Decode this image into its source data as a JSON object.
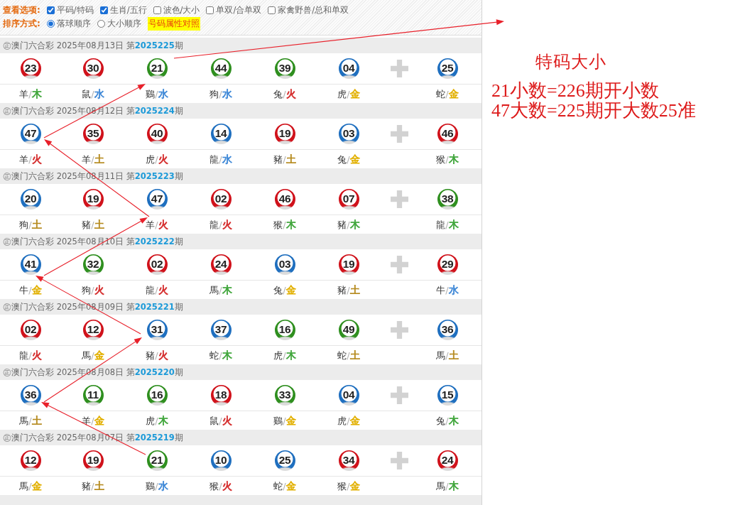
{
  "options": {
    "label": "查看选项:",
    "checkboxes": [
      {
        "label": "平码/特码",
        "checked": true
      },
      {
        "label": "生肖/五行",
        "checked": true
      },
      {
        "label": "波色/大小",
        "checked": false
      },
      {
        "label": "单双/合单双",
        "checked": false
      },
      {
        "label": "家禽野兽/总和单双",
        "checked": false
      }
    ]
  },
  "sort": {
    "label": "排序方式:",
    "radios": [
      {
        "label": "落球顺序",
        "selected": true
      },
      {
        "label": "大小顺序",
        "selected": false
      }
    ],
    "button": "号码属性对照"
  },
  "draws": [
    {
      "header": "㊣澳门六合彩 2025年08月13日 第**2025225**期",
      "balls": [
        {
          "number": "23",
          "color": "#d0121b",
          "label": {
            "zodiac": "羊",
            "separator": "/",
            "element": "木",
            "color": "#41a63c"
          }
        },
        {
          "number": "30",
          "color": "#d0121b",
          "label": {
            "zodiac": "鼠",
            "separator": "/",
            "element": "水",
            "color": "#3b86d6"
          }
        },
        {
          "number": "21",
          "color": "#2f8f1f",
          "label": {
            "zodiac": "鷄",
            "separator": "/",
            "element": "水",
            "color": "#3b86d6"
          }
        },
        {
          "number": "44",
          "color": "#2f8f1f",
          "label": {
            "zodiac": "狗",
            "separator": "/",
            "element": "水",
            "color": "#3b86d6"
          }
        },
        {
          "number": "39",
          "color": "#2f8f1f",
          "label": {
            "zodiac": "兔",
            "separator": "/",
            "element": "火",
            "color": "#d42a2a"
          }
        },
        {
          "number": "04",
          "color": "#1f6fbf",
          "label": {
            "zodiac": "虎",
            "separator": "/",
            "element": "金",
            "color": "#e2b000"
          }
        }
      ],
      "special_ball": {
        "number": "25",
        "color": "#1f6fbf",
        "label": {
          "zodiac": "蛇",
          "separator": "/",
          "element": "金",
          "color": "#e2b000"
        }
      }
    },
    {
      "header": "㊣澳门六合彩 2025年08月12日 第**2025224**期",
      "balls": [
        {
          "number": "47",
          "color": "#1f6fbf",
          "label": {
            "zodiac": "羊",
            "separator": "/",
            "element": "火",
            "color": "#d42a2a"
          }
        },
        {
          "number": "35",
          "color": "#d0121b",
          "label": {
            "zodiac": "羊",
            "separator": "/",
            "element": "土",
            "color": "#b58a1e"
          }
        },
        {
          "number": "40",
          "color": "#d0121b",
          "label": {
            "zodiac": "虎",
            "separator": "/",
            "element": "火",
            "color": "#d42a2a"
          }
        },
        {
          "number": "14",
          "color": "#1f6fbf",
          "label": {
            "zodiac": "龍",
            "separator": "/",
            "element": "水",
            "color": "#3b86d6"
          }
        },
        {
          "number": "19",
          "color": "#d0121b",
          "label": {
            "zodiac": "豬",
            "separator": "/",
            "element": "土",
            "color": "#b58a1e"
          }
        },
        {
          "number": "03",
          "color": "#1f6fbf",
          "label": {
            "zodiac": "兔",
            "separator": "/",
            "element": "金",
            "color": "#e2b000"
          }
        }
      ],
      "special_ball": {
        "number": "46",
        "color": "#d0121b",
        "label": {
          "zodiac": "猴",
          "separator": "/",
          "element": "木",
          "color": "#41a63c"
        }
      }
    },
    {
      "header": "㊣澳门六合彩 2025年08月11日 第**2025223**期",
      "balls": [
        {
          "number": "20",
          "color": "#1f6fbf",
          "label": {
            "zodiac": "狗",
            "separator": "/",
            "element": "土",
            "color": "#b58a1e"
          }
        },
        {
          "number": "19",
          "color": "#d0121b",
          "label": {
            "zodiac": "豬",
            "separator": "/",
            "element": "土",
            "color": "#b58a1e"
          }
        },
        {
          "number": "47",
          "color": "#1f6fbf",
          "label": {
            "zodiac": "羊",
            "separator": "/",
            "element": "火",
            "color": "#d42a2a"
          }
        },
        {
          "number": "02",
          "color": "#d0121b",
          "label": {
            "zodiac": "龍",
            "separator": "/",
            "element": "火",
            "color": "#d42a2a"
          }
        },
        {
          "number": "46",
          "color": "#d0121b",
          "label": {
            "zodiac": "猴",
            "separator": "/",
            "element": "木",
            "color": "#41a63c"
          }
        },
        {
          "number": "07",
          "color": "#d0121b",
          "label": {
            "zodiac": "豬",
            "separator": "/",
            "element": "木",
            "color": "#41a63c"
          }
        }
      ],
      "special_ball": {
        "number": "38",
        "color": "#2f8f1f",
        "label": {
          "zodiac": "龍",
          "separator": "/",
          "element": "木",
          "color": "#41a63c"
        }
      }
    },
    {
      "header": "㊣澳门六合彩 2025年08月10日 第**2025222**期",
      "balls": [
        {
          "number": "41",
          "color": "#1f6fbf",
          "label": {
            "zodiac": "牛",
            "separator": "/",
            "element": "金",
            "color": "#e2b000"
          }
        },
        {
          "number": "32",
          "color": "#2f8f1f",
          "label": {
            "zodiac": "狗",
            "separator": "/",
            "element": "火",
            "color": "#d42a2a"
          }
        },
        {
          "number": "02",
          "color": "#d0121b",
          "label": {
            "zodiac": "龍",
            "separator": "/",
            "element": "火",
            "color": "#d42a2a"
          }
        },
        {
          "number": "24",
          "color": "#d0121b",
          "label": {
            "zodiac": "馬",
            "separator": "/",
            "element": "木",
            "color": "#41a63c"
          }
        },
        {
          "number": "03",
          "color": "#1f6fbf",
          "label": {
            "zodiac": "兔",
            "separator": "/",
            "element": "金",
            "color": "#e2b000"
          }
        },
        {
          "number": "19",
          "color": "#d0121b",
          "label": {
            "zodiac": "豬",
            "separator": "/",
            "element": "土",
            "color": "#b58a1e"
          }
        }
      ],
      "special_ball": {
        "number": "29",
        "color": "#d0121b",
        "label": {
          "zodiac": "牛",
          "separator": "/",
          "element": "水",
          "color": "#3b86d6"
        }
      }
    },
    {
      "header": "㊣澳门六合彩 2025年08月09日 第**2025221**期",
      "balls": [
        {
          "number": "02",
          "color": "#d0121b",
          "label": {
            "zodiac": "龍",
            "separator": "/",
            "element": "火",
            "color": "#d42a2a"
          }
        },
        {
          "number": "12",
          "color": "#d0121b",
          "label": {
            "zodiac": "馬",
            "separator": "/",
            "element": "金",
            "color": "#e2b000"
          }
        },
        {
          "number": "31",
          "color": "#1f6fbf",
          "label": {
            "zodiac": "豬",
            "separator": "/",
            "element": "火",
            "color": "#d42a2a"
          }
        },
        {
          "number": "37",
          "color": "#1f6fbf",
          "label": {
            "zodiac": "蛇",
            "separator": "/",
            "element": "木",
            "color": "#41a63c"
          }
        },
        {
          "number": "16",
          "color": "#2f8f1f",
          "label": {
            "zodiac": "虎",
            "separator": "/",
            "element": "木",
            "color": "#41a63c"
          }
        },
        {
          "number": "49",
          "color": "#2f8f1f",
          "label": {
            "zodiac": "蛇",
            "separator": "/",
            "element": "土",
            "color": "#b58a1e"
          }
        }
      ],
      "special_ball": {
        "number": "36",
        "color": "#1f6fbf",
        "label": {
          "zodiac": "馬",
          "separator": "/",
          "element": "土",
          "color": "#b58a1e"
        }
      }
    },
    {
      "header": "㊣澳门六合彩 2025年08月08日 第**2025220**期",
      "balls": [
        {
          "number": "36",
          "color": "#1f6fbf",
          "label": {
            "zodiac": "馬",
            "separator": "/",
            "element": "土",
            "color": "#b58a1e"
          }
        },
        {
          "number": "11",
          "color": "#2f8f1f",
          "label": {
            "zodiac": "羊",
            "separator": "/",
            "element": "金",
            "color": "#e2b000"
          }
        },
        {
          "number": "16",
          "color": "#2f8f1f",
          "label": {
            "zodiac": "虎",
            "separator": "/",
            "element": "木",
            "color": "#41a63c"
          }
        },
        {
          "number": "18",
          "color": "#d0121b",
          "label": {
            "zodiac": "鼠",
            "separator": "/",
            "element": "火",
            "color": "#d42a2a"
          }
        },
        {
          "number": "33",
          "color": "#2f8f1f",
          "label": {
            "zodiac": "鷄",
            "separator": "/",
            "element": "金",
            "color": "#e2b000"
          }
        },
        {
          "number": "04",
          "color": "#1f6fbf",
          "label": {
            "zodiac": "虎",
            "separator": "/",
            "element": "金",
            "color": "#e2b000"
          }
        }
      ],
      "special_ball": {
        "number": "15",
        "color": "#1f6fbf",
        "label": {
          "zodiac": "兔",
          "separator": "/",
          "element": "木",
          "color": "#41a63c"
        }
      }
    },
    {
      "header": "㊣澳门六合彩 2025年08月07日 第**2025219**期",
      "balls": [
        {
          "number": "12",
          "color": "#d0121b",
          "label": {
            "zodiac": "馬",
            "separator": "/",
            "element": "金",
            "color": "#e2b000"
          }
        },
        {
          "number": "19",
          "color": "#d0121b",
          "label": {
            "zodiac": "豬",
            "separator": "/",
            "element": "土",
            "color": "#b58a1e"
          }
        },
        {
          "number": "21",
          "color": "#2f8f1f",
          "label": {
            "zodiac": "鷄",
            "separator": "/",
            "element": "水",
            "color": "#3b86d6"
          }
        },
        {
          "number": "10",
          "color": "#1f6fbf",
          "label": {
            "zodiac": "猴",
            "separator": "/",
            "element": "火",
            "color": "#d42a2a"
          }
        },
        {
          "number": "25",
          "color": "#1f6fbf",
          "label": {
            "zodiac": "蛇",
            "separator": "/",
            "element": "金",
            "color": "#e2b000"
          }
        },
        {
          "number": "34",
          "color": "#d0121b",
          "label": {
            "zodiac": "猴",
            "separator": "/",
            "element": "金",
            "color": "#e2b000"
          }
        }
      ],
      "special_ball": {
        "number": "24",
        "color": "#d0121b",
        "label": {
          "zodiac": "馬",
          "separator": "/",
          "element": "木",
          "color": "#41a63c"
        }
      }
    }
  ],
  "note": {
    "title": "特码大小",
    "lines": [
      "21小数=226期开小数",
      "47大数=225期开大数25准"
    ]
  }
}
